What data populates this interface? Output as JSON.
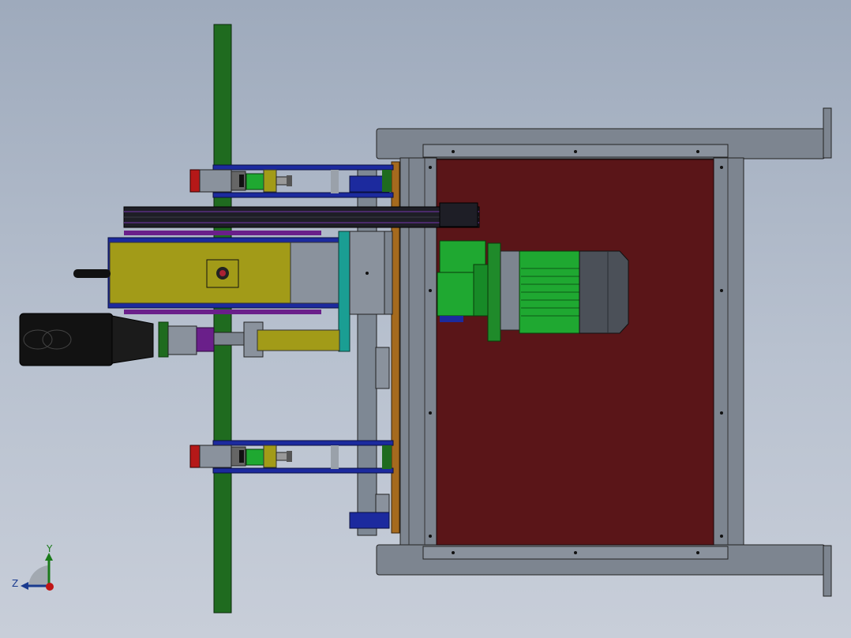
{
  "viewport": {
    "title": ""
  },
  "triad": {
    "y_label": "Y",
    "z_label": "Z"
  },
  "colors": {
    "background_top": "#9eaabc",
    "frame_gray": "#7d8590",
    "panel_red": "#5a1518",
    "shaft_green": "#1f6b1f",
    "motor_green": "#1fa831",
    "housing_yellow": "#a29b18",
    "bracket_blue": "#1c2a9e",
    "teal": "#1a9e93"
  }
}
